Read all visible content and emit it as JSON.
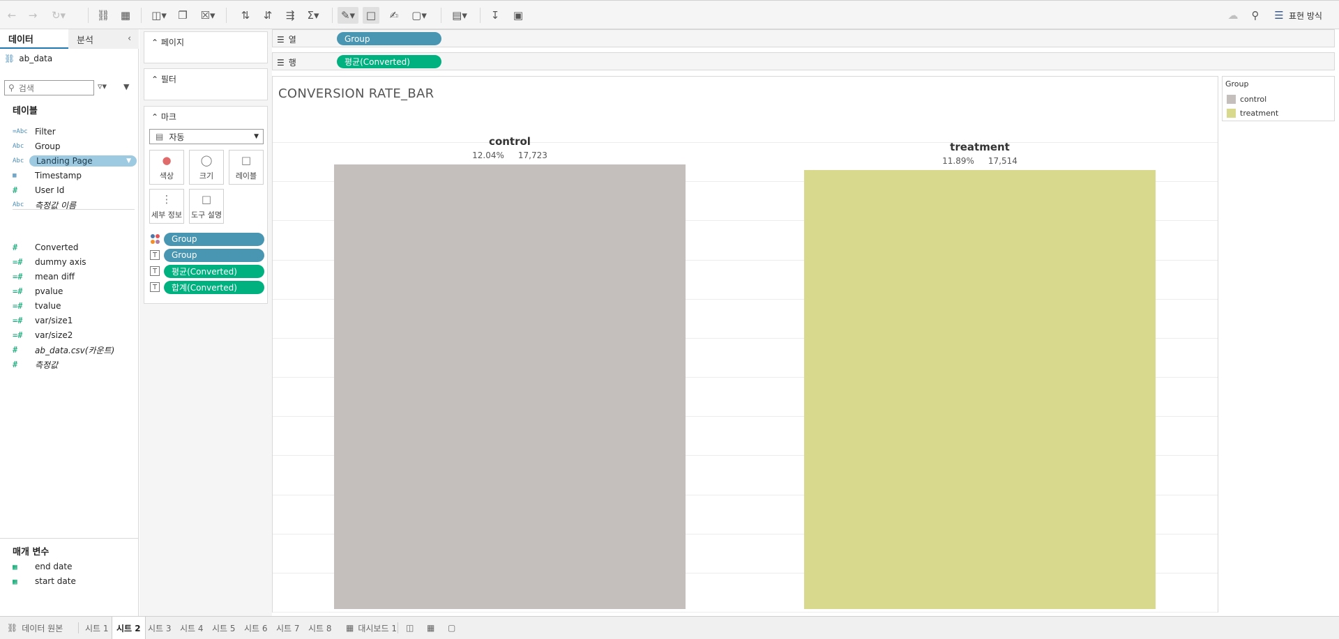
{
  "toolbar": {
    "right_label": "표현 방식",
    "icons": [
      "back-icon",
      "forward-icon",
      "redo-icon",
      "new-datasource-icon",
      "datasource-icon",
      "new-worksheet-icon",
      "duplicate-icon",
      "clear-icon",
      "swap-icon",
      "sort-asc-icon",
      "sort-desc-icon",
      "totals-icon",
      "highlight-icon",
      "label-icon",
      "annotate-icon",
      "fit-icon",
      "chart-icon",
      "download-icon",
      "present-icon",
      "cloud-icon",
      "pin-icon",
      "show-me-icon"
    ]
  },
  "datapane": {
    "tab_data": "데이터",
    "tab_analysis": "분석",
    "datasource": "ab_data",
    "search_placeholder": "검색",
    "tables_title": "테이블",
    "dimensions": [
      {
        "type": "=Abc",
        "name": "Filter"
      },
      {
        "type": "Abc",
        "name": "Group"
      },
      {
        "type": "Abc",
        "name": "Landing Page",
        "selected": true
      },
      {
        "type": "date",
        "name": "Timestamp"
      },
      {
        "type": "#",
        "name": "User Id"
      },
      {
        "type": "Abc",
        "name": "측정값 이름",
        "italic": true
      }
    ],
    "measures": [
      {
        "type": "#",
        "name": "Converted"
      },
      {
        "type": "=#",
        "name": "dummy axis"
      },
      {
        "type": "=#",
        "name": "mean diff"
      },
      {
        "type": "=#",
        "name": "pvalue"
      },
      {
        "type": "=#",
        "name": "tvalue"
      },
      {
        "type": "=#",
        "name": "var/size1"
      },
      {
        "type": "=#",
        "name": "var/size2"
      },
      {
        "type": "#",
        "name": "ab_data.csv(카운트)",
        "italic": true
      },
      {
        "type": "#",
        "name": "측정값",
        "italic": true
      }
    ],
    "params_title": "매개 변수",
    "params": [
      {
        "name": "end date"
      },
      {
        "name": "start date"
      }
    ]
  },
  "cards": {
    "pages_title": "페이지",
    "filters_title": "필터",
    "marks_title": "마크",
    "mark_type": "자동",
    "buttons": {
      "color": "색상",
      "size": "크기",
      "label": "레이블",
      "detail": "세부 정보",
      "tooltip": "도구 설명"
    },
    "pills": [
      {
        "icon": "color",
        "label": "Group",
        "kind": "dim"
      },
      {
        "icon": "T",
        "label": "Group",
        "kind": "dim"
      },
      {
        "icon": "T",
        "label": "평균(Converted)",
        "kind": "mea"
      },
      {
        "icon": "T",
        "label": "합계(Converted)",
        "kind": "mea"
      }
    ]
  },
  "shelves": {
    "columns_label": "열",
    "columns_pill": "Group",
    "rows_label": "행",
    "rows_pill": "평균(Converted)"
  },
  "view": {
    "title": "CONVERSION RATE_BAR"
  },
  "chart_data": {
    "type": "bar",
    "title": "CONVERSION RATE_BAR",
    "categories": [
      "control",
      "treatment"
    ],
    "values": [
      0.1204,
      0.1189
    ],
    "value_labels": [
      "12.04%",
      "11.89%"
    ],
    "sum_labels": [
      "17,723",
      "17,514"
    ],
    "colors": [
      "#c4bfbd",
      "#d8d98c"
    ],
    "ylim": [
      0,
      0.1204
    ],
    "grid": true,
    "legend": "top-right",
    "xlabel": "",
    "ylabel": ""
  },
  "legend": {
    "title": "Group",
    "items": [
      {
        "label": "control",
        "color": "#c4bfbd"
      },
      {
        "label": "treatment",
        "color": "#d8d98c"
      }
    ]
  },
  "bottom_tabs": {
    "datasource": "데이터 원본",
    "sheets": [
      "시트 1",
      "시트 2",
      "시트 3",
      "시트 4",
      "시트 5",
      "시트 6",
      "시트 7",
      "시트 8"
    ],
    "active_sheet": "시트 2",
    "dashboard": "대시보드 1"
  }
}
